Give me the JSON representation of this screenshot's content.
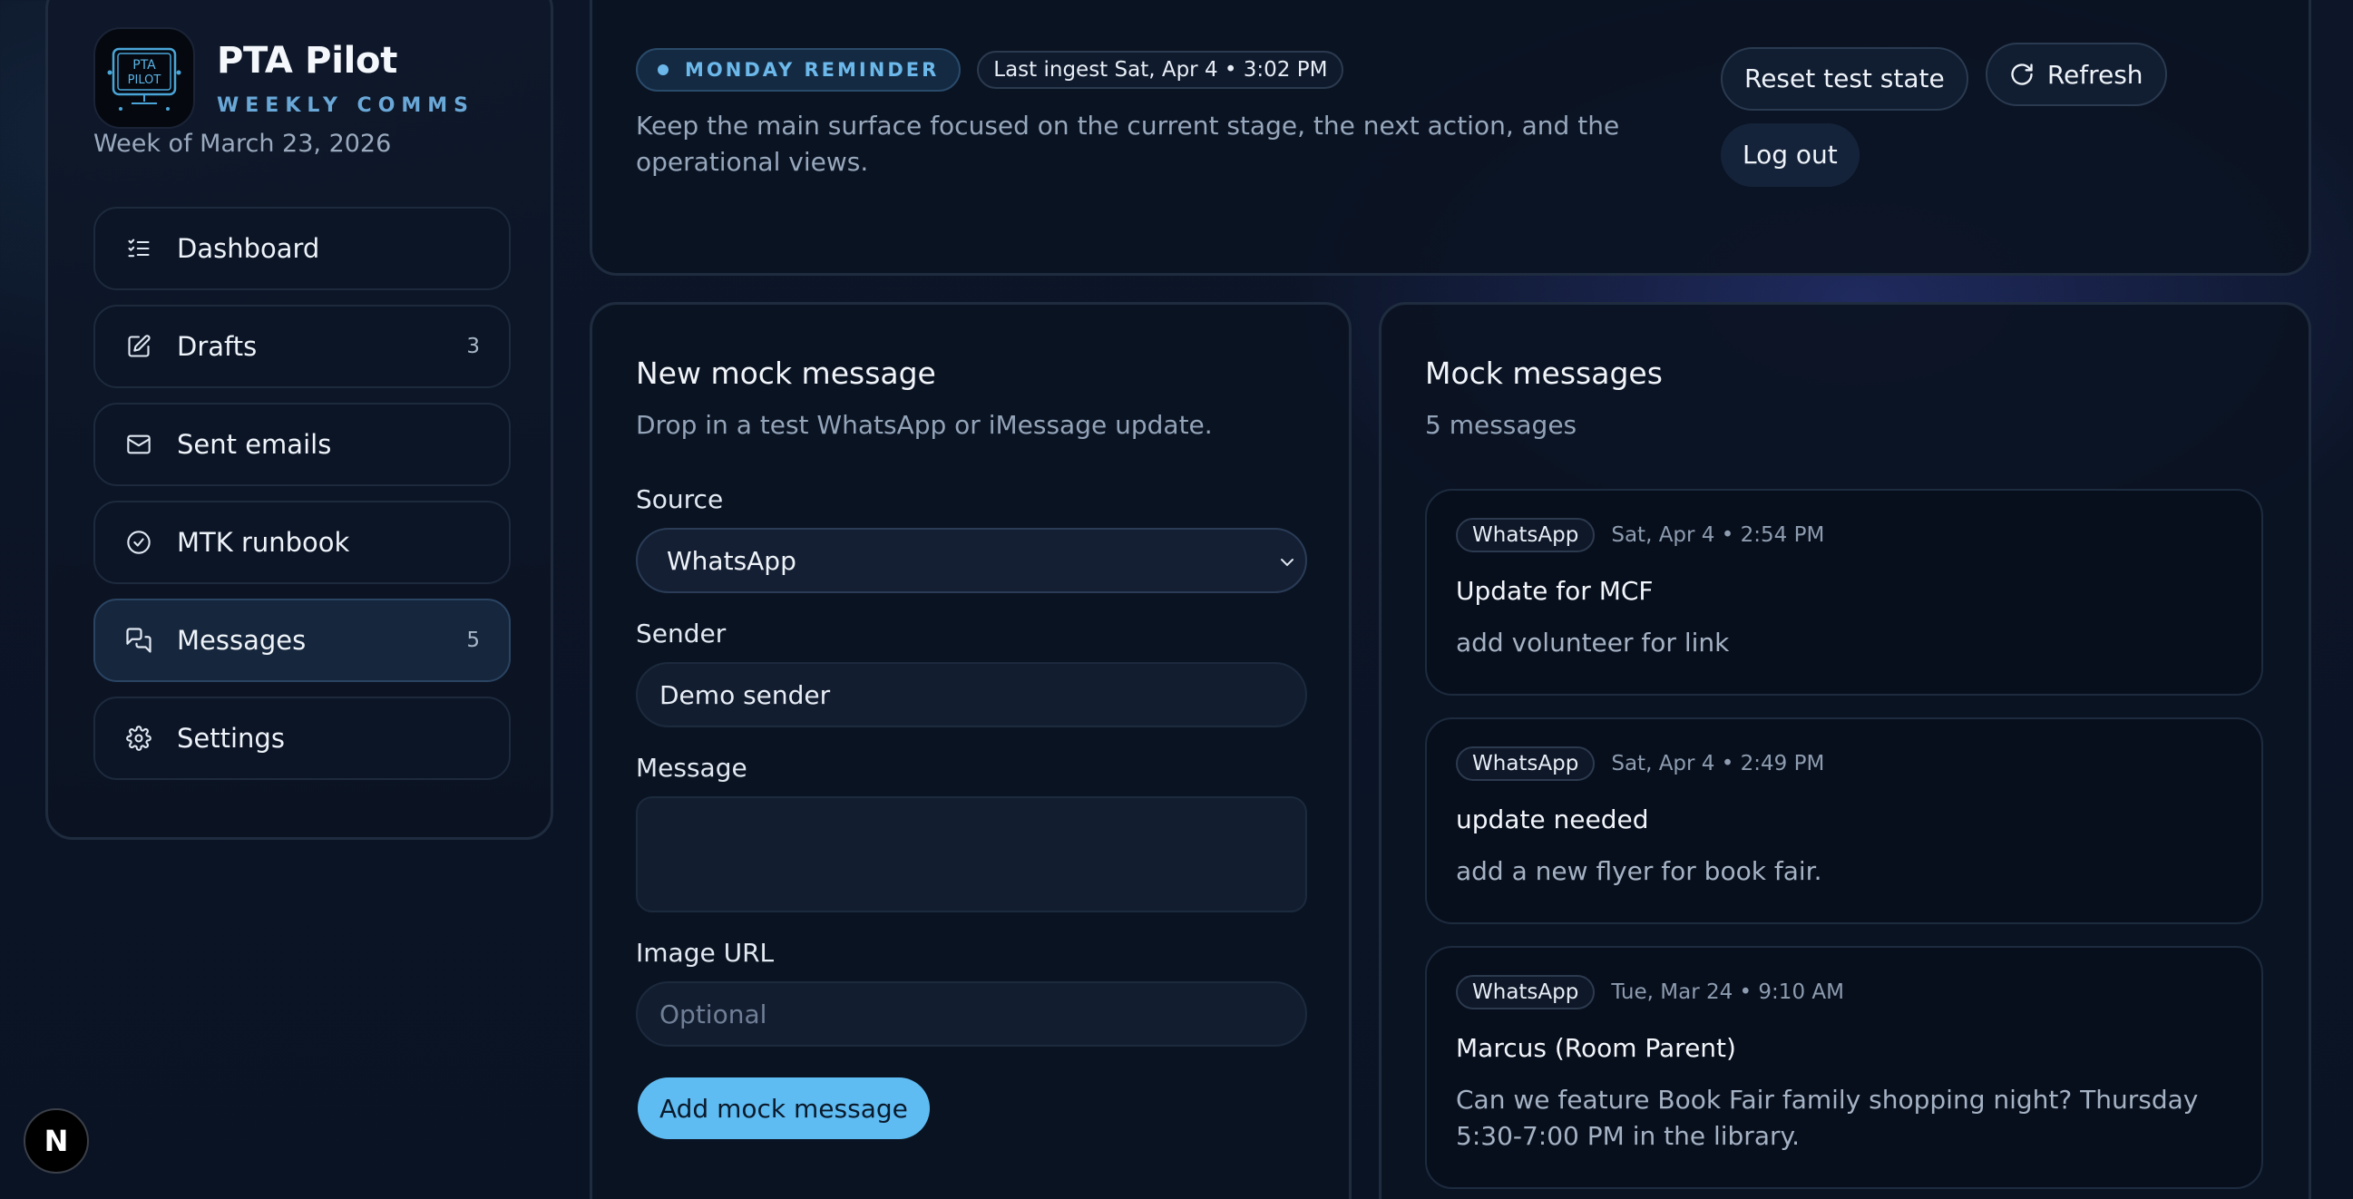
{
  "brand": {
    "name": "PTA Pilot",
    "subtitle": "WEEKLY COMMS",
    "logo_text_line1": "PTA",
    "logo_text_line2": "PILOT",
    "week_label": "Week of March 23, 2026"
  },
  "nav": {
    "items": [
      {
        "label": "Dashboard",
        "icon": "checklist-icon",
        "badge": ""
      },
      {
        "label": "Drafts",
        "icon": "edit-icon",
        "badge": "3"
      },
      {
        "label": "Sent emails",
        "icon": "mail-icon",
        "badge": ""
      },
      {
        "label": "MTK runbook",
        "icon": "check-circle-icon",
        "badge": ""
      },
      {
        "label": "Messages",
        "icon": "chat-bubbles-icon",
        "badge": "5",
        "active": true
      },
      {
        "label": "Settings",
        "icon": "gear-icon",
        "badge": ""
      }
    ]
  },
  "header": {
    "reminder_pill": "MONDAY REMINDER",
    "ingest_pill": "Last ingest Sat, Apr 4 • 3:02 PM",
    "description": "Keep the main surface focused on the current stage, the next action, and the operational views.",
    "reset_label": "Reset test state",
    "refresh_label": "Refresh",
    "logout_label": "Log out"
  },
  "form": {
    "title": "New mock message",
    "subtitle": "Drop in a test WhatsApp or iMessage update.",
    "source_label": "Source",
    "source_value": "WhatsApp",
    "sender_label": "Sender",
    "sender_value": "Demo sender",
    "message_label": "Message",
    "message_value": "",
    "image_label": "Image URL",
    "image_placeholder": "Optional",
    "submit_label": "Add mock message"
  },
  "messages": {
    "title": "Mock messages",
    "count_label": "5 messages",
    "items": [
      {
        "source": "WhatsApp",
        "time": "Sat, Apr 4 • 2:54 PM",
        "title": "Update for MCF",
        "body": "add volunteer for link"
      },
      {
        "source": "WhatsApp",
        "time": "Sat, Apr 4 • 2:49 PM",
        "title": "update needed",
        "body": "add a new flyer for book fair."
      },
      {
        "source": "WhatsApp",
        "time": "Tue, Mar 24 • 9:10 AM",
        "title": "Marcus (Room Parent)",
        "body": "Can we feature Book Fair family shopping night? Thursday 5:30-7:00 PM in the library."
      }
    ]
  },
  "dev_badge": "N",
  "colors": {
    "accent": "#5fbcf2",
    "background": "#0a1324",
    "card": "#0b1322"
  }
}
